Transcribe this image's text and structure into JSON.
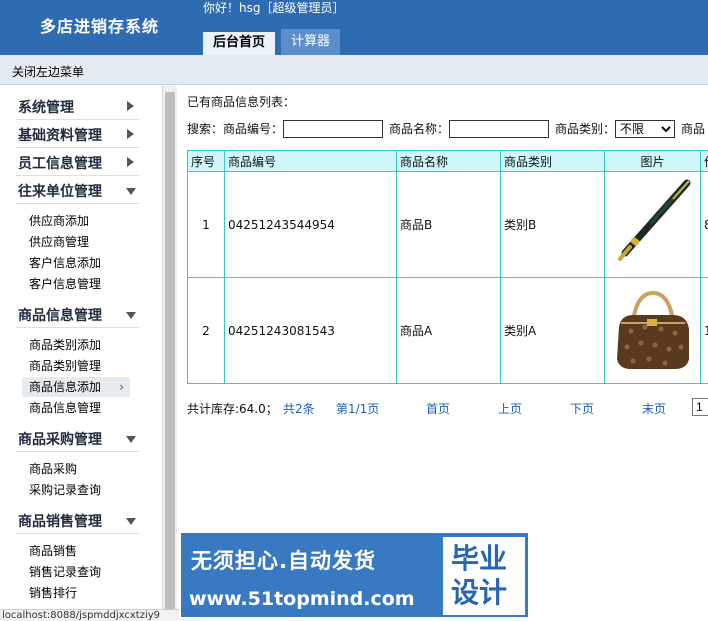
{
  "header": {
    "app_title": "多店进销存系统",
    "greeting": "你好！hsg［超级管理员］",
    "tabs": [
      {
        "label": "后台首页",
        "active": true
      },
      {
        "label": "计算器",
        "active": false
      }
    ]
  },
  "toolbar": {
    "close_menu": "关闭左边菜单"
  },
  "sidebar": {
    "groups": [
      {
        "label": "系统管理",
        "expanded": false,
        "items": []
      },
      {
        "label": "基础资料管理",
        "expanded": false,
        "items": []
      },
      {
        "label": "员工信息管理",
        "expanded": false,
        "items": []
      },
      {
        "label": "往来单位管理",
        "expanded": true,
        "items": [
          "供应商添加",
          "供应商管理",
          "客户信息添加",
          "客户信息管理"
        ]
      },
      {
        "label": "商品信息管理",
        "expanded": true,
        "items": [
          "商品类别添加",
          "商品类别管理",
          "商品信息添加",
          "商品信息管理"
        ]
      },
      {
        "label": "商品采购管理",
        "expanded": true,
        "items": [
          "商品采购",
          "采购记录查询"
        ]
      },
      {
        "label": "商品销售管理",
        "expanded": true,
        "items": [
          "商品销售",
          "销售记录查询",
          "销售排行"
        ]
      }
    ],
    "active_item": "商品信息添加"
  },
  "main": {
    "list_title": "已有商品信息列表：",
    "search": {
      "label": "搜索：",
      "code_label": "商品编号：",
      "code_value": "",
      "name_label": "商品名称：",
      "name_value": "",
      "category_label": "商品类别：",
      "category_selected": "不限",
      "extra_label": "商品"
    },
    "table": {
      "columns": [
        "序号",
        "商品编号",
        "商品名称",
        "商品类别",
        "图片",
        "价"
      ],
      "rows": [
        {
          "index": "1",
          "code": "04251243544954",
          "name": "商品B",
          "category": "类别B",
          "image": "pen-image",
          "extra": "8"
        },
        {
          "index": "2",
          "code": "04251243081543",
          "name": "商品A",
          "category": "类别A",
          "image": "handbag-image",
          "extra": "1"
        }
      ]
    },
    "pager": {
      "stock": "共计库存:64.0；",
      "total": "共2条",
      "page_info": "第1/1页",
      "first": "首页",
      "prev": "上页",
      "next": "下页",
      "last": "末页",
      "page_input": "1"
    }
  },
  "statusbar": {
    "url": "localhost:8088/jspmddjxcxtziy9"
  },
  "watermark": {
    "line1": "无须担心.自动发货",
    "line2": "www.51topmind.com",
    "badge_top": "毕业",
    "badge_bottom": "设计"
  },
  "colors": {
    "header_bg": "#2f6bb0",
    "table_border": "#3ac7cc",
    "table_header_bg": "#cff7f7",
    "link": "#1b5fb4"
  }
}
